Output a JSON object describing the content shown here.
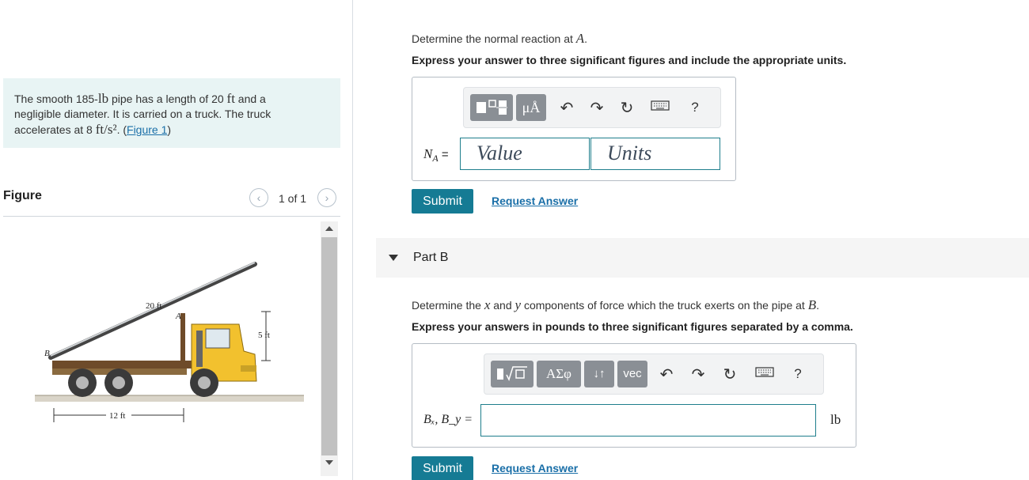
{
  "problem": {
    "text_1": "The smooth 185-",
    "weight_unit": "lb",
    "text_2": " pipe has a length of 20 ",
    "length_unit": "ft",
    "text_3": " and a",
    "line_2": "negligible diameter. It is carried on a truck. The truck",
    "text_4": "accelerates at 8 ",
    "accel_unit": "ft/s²",
    "text_5": ". (",
    "figure_link": "Figure 1",
    "text_6": ")"
  },
  "figure": {
    "title": "Figure",
    "counter": "1 of 1",
    "prev_icon": "chevron-left-icon",
    "next_icon": "chevron-right-icon",
    "labels": {
      "pipe_length": "20 ft",
      "point_a": "A",
      "point_b": "B",
      "height": "5 ft",
      "distance": "12 ft"
    }
  },
  "part_a": {
    "prompt_1": "Determine the normal reaction at ",
    "prompt_var": "A",
    "prompt_2": ".",
    "instruction": "Express your answer to three significant figures and include the appropriate units.",
    "label": "N",
    "label_sub": "A",
    "equals": "=",
    "value_placeholder": "Value",
    "units_placeholder": "Units",
    "submit": "Submit",
    "request": "Request Answer",
    "toolbar": {
      "templates_icon": "templates-icon",
      "units_btn": "μÅ",
      "undo_icon": "undo-icon",
      "redo_icon": "redo-icon",
      "reset_icon": "reset-icon",
      "keyboard_icon": "keyboard-icon",
      "help": "?"
    }
  },
  "part_b": {
    "title": "Part B",
    "prompt_1": "Determine the ",
    "var_x": "x",
    "prompt_and": " and ",
    "var_y": "y",
    "prompt_2": " components of force which the truck exerts on the pipe at ",
    "var_b": "B",
    "prompt_3": ".",
    "instruction": "Express your answers in pounds to three significant figures separated by a comma.",
    "label": "Bₓ, B_y =",
    "unit": "lb",
    "submit": "Submit",
    "request": "Request Answer",
    "toolbar": {
      "templates_icon": "templates-sqrt-icon",
      "greek_btn": "ΑΣφ",
      "arrows_btn": "↓↑",
      "vec_btn": "vec",
      "undo_icon": "undo-icon",
      "redo_icon": "redo-icon",
      "reset_icon": "reset-icon",
      "keyboard_icon": "keyboard-icon",
      "help": "?"
    }
  },
  "colors": {
    "accent": "#157b94",
    "problem_bg": "#e8f4f4",
    "link": "#1a6fa8"
  }
}
